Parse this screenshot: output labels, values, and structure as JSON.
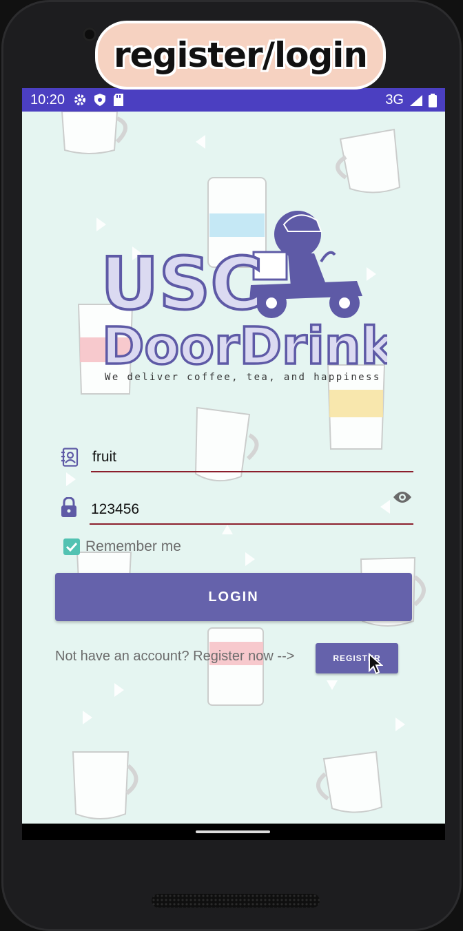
{
  "caption": "register/login",
  "status_bar": {
    "time": "10:20",
    "network": "3G"
  },
  "logo": {
    "line1": "USC",
    "line2": "DoorDrink",
    "tagline": "We deliver coffee, tea, and happiness"
  },
  "form": {
    "username_value": "fruit",
    "password_value": "123456",
    "remember_label": "Remember me",
    "remember_checked": true
  },
  "login_label": "LOGIN",
  "register_prompt": "Not have an account? Register now -->",
  "register_label": "REGISTER",
  "colors": {
    "primary": "#6562ab",
    "status_bar": "#4b3fc1",
    "background": "#e5f5f1",
    "accent_check": "#52c2b2",
    "underline": "#8b1e2c"
  }
}
